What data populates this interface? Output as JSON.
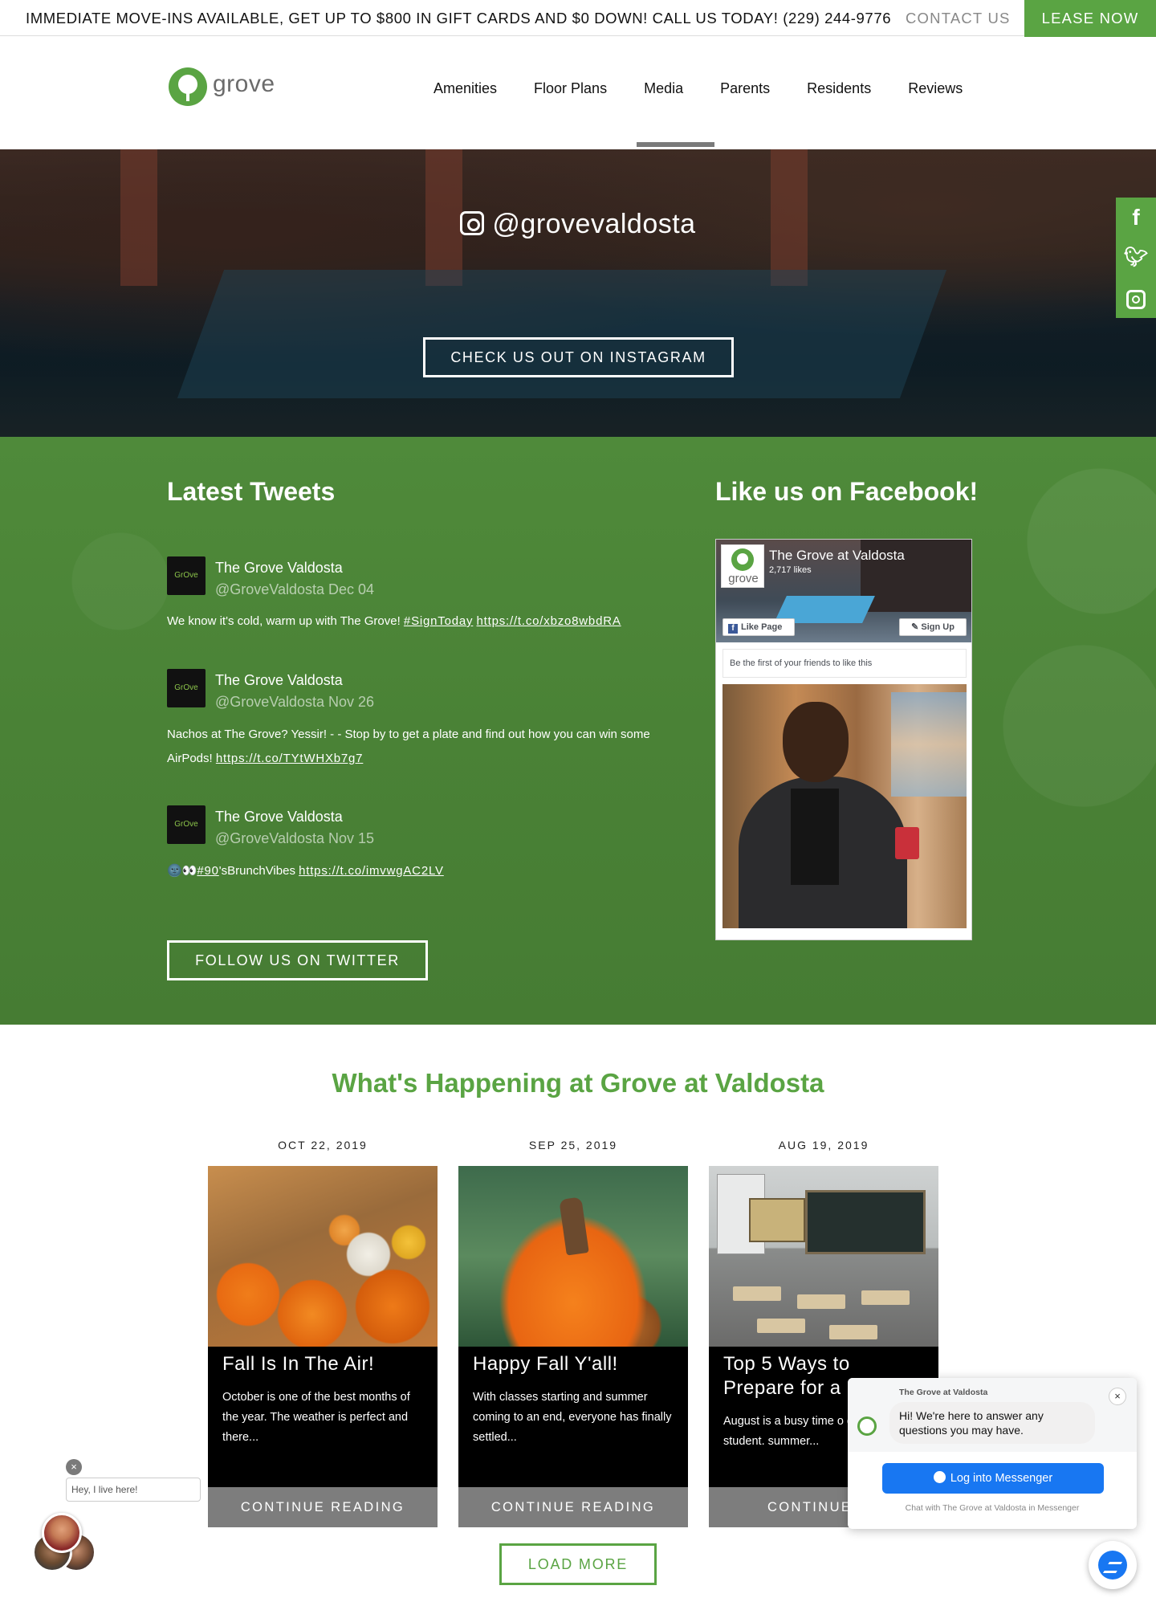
{
  "topbar": {
    "promo": "IMMEDIATE MOVE-INS AVAILABLE, GET UP TO $800 IN GIFT CARDS AND $0 DOWN! CALL US TODAY! (229) 244-9776",
    "contact": "CONTACT US",
    "lease": "LEASE NOW"
  },
  "logo": {
    "text": "grove"
  },
  "nav": [
    "Amenities",
    "Floor Plans",
    "Media",
    "Parents",
    "Residents",
    "Reviews"
  ],
  "nav_active": "Media",
  "hero": {
    "handle": "@grovevaldosta",
    "button": "CHECK US OUT ON INSTAGRAM"
  },
  "social": [
    {
      "icon": "facebook-icon",
      "glyph": "f"
    },
    {
      "icon": "twitter-icon",
      "glyph": "t"
    },
    {
      "icon": "instagram-icon",
      "glyph": "ig"
    }
  ],
  "tweets_section": {
    "title": "Latest Tweets",
    "tweets": [
      {
        "name": "The Grove Valdosta",
        "handle_date": "@GroveValdosta Dec 04",
        "text": "We know it's cold, warm up with The Grove! ",
        "tag": "#SignToday",
        "link": "https://t.co/xbzo8wbdRA"
      },
      {
        "name": "The Grove Valdosta",
        "handle_date": "@GroveValdosta Nov 26",
        "text": "Nachos at The Grove? Yessir! - - Stop by to get a plate and find out how you can win some AirPods! ",
        "link": "https://t.co/TYtWHXb7g7"
      },
      {
        "name": "The Grove Valdosta",
        "handle_date": "@GroveValdosta Nov 15",
        "text": "'sBrunchVibes ",
        "emoji": "🌚👀",
        "tag": "#90",
        "link": "https://t.co/imvwgAC2LV"
      }
    ],
    "avatar_text": "GrOve",
    "follow_button": "FOLLOW US ON TWITTER"
  },
  "facebook": {
    "title": "Like us on Facebook!",
    "page_name": "The Grove at Valdosta",
    "likes": "2,717 likes",
    "logo_word": "grove",
    "like_button": "Like Page",
    "signup_button": "Sign Up",
    "friends_text": "Be the first of your friends to like this"
  },
  "happening": {
    "title": "What's Happening at Grove at Valdosta",
    "posts": [
      {
        "date": "OCT 22, 2019",
        "title": "Fall Is In The Air!",
        "excerpt": "October is one of the best months of the year. The weather is perfect and there...",
        "more": "CONTINUE READING"
      },
      {
        "date": "SEP 25, 2019",
        "title": "Happy Fall Y'all!",
        "excerpt": "With classes starting and summer coming to an end, everyone has finally settled...",
        "more": "CONTINUE READING"
      },
      {
        "date": "AUG 19, 2019",
        "title": "Top 5 Ways to Prepare for a N",
        "excerpt": "August is a busy time o every college student. summer...",
        "more": "CONTINUE RE"
      }
    ],
    "load_more": "LOAD MORE"
  },
  "live_widget": {
    "close": "×",
    "bubble": "Hey, I live here!"
  },
  "messenger": {
    "page": "The Grove at Valdosta",
    "close": "×",
    "greeting": "Hi! We're here to answer any questions you may have.",
    "login": "Log into Messenger",
    "footer": "Chat with The Grove at Valdosta in Messenger"
  },
  "colors": {
    "brand_green": "#5aa443",
    "messenger_blue": "#1877f2",
    "continue_gray": "#7d7d7d"
  }
}
